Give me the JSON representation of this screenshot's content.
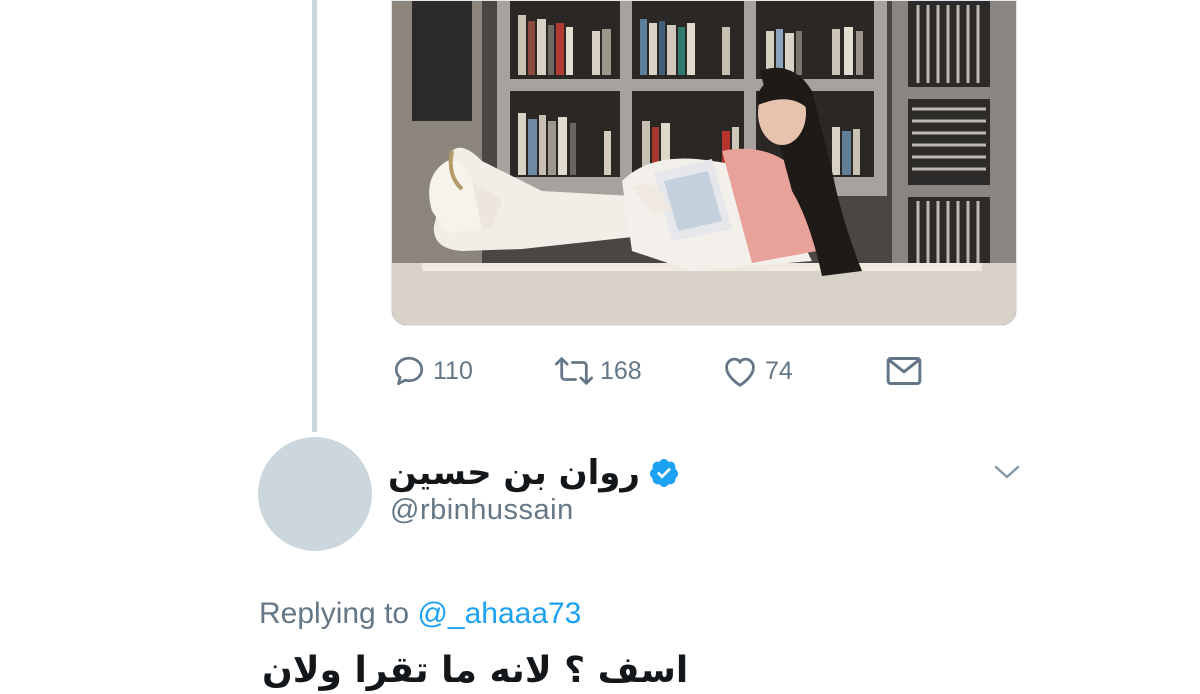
{
  "tweet": {
    "stats": {
      "replies": "110",
      "retweets": "168",
      "likes": "74"
    }
  },
  "reply": {
    "display_name": "روان بن حسين",
    "handle": "@rbinhussain",
    "verified": true,
    "replying_prefix": "Replying to",
    "replying_to": "@_ahaaa73",
    "text": "اسف ؟ لانه ما تقرا ولان"
  },
  "icons": {
    "reply": "reply-icon",
    "retweet": "retweet-icon",
    "like": "heart-icon",
    "dm": "envelope-icon",
    "verified": "verified-badge-icon",
    "caret": "chevron-down-icon"
  },
  "colors": {
    "accent": "#1da1f2",
    "secondary_text": "#657786",
    "primary_text": "#14171a",
    "thread_line": "#ccd6dd",
    "avatar_placeholder": "#ccd6dd"
  }
}
